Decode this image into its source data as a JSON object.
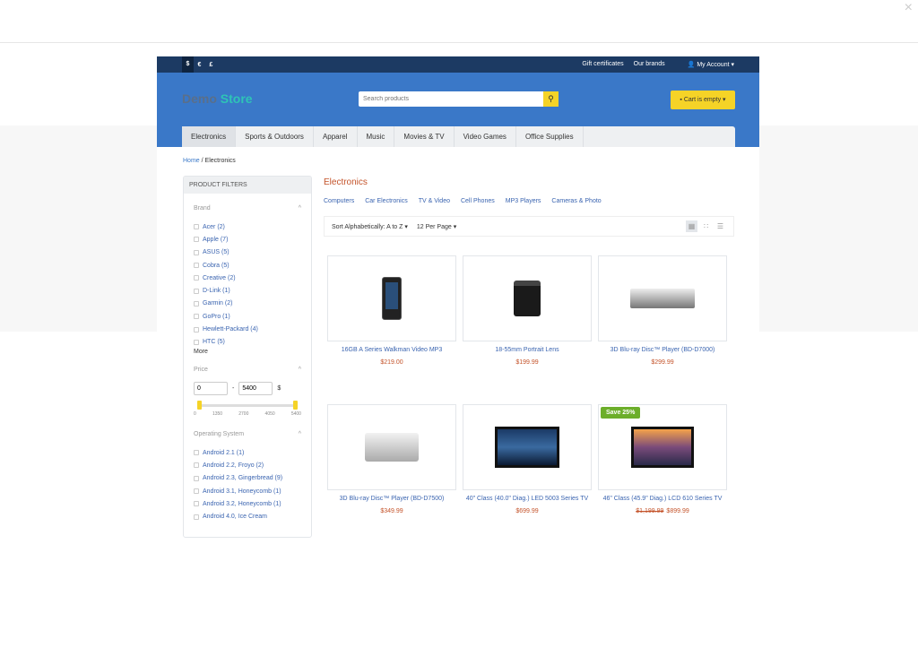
{
  "window": {
    "close_icon": "×"
  },
  "topbar": {
    "currencies": [
      "$",
      "€",
      "£"
    ],
    "links": [
      "Gift certificates",
      "Our brands"
    ],
    "account": "My Account ▾"
  },
  "header": {
    "logo_a": "Demo",
    "logo_b": "Store",
    "search_placeholder": "Search products",
    "cart": "Cart is empty ▾"
  },
  "nav": [
    "Electronics",
    "Sports & Outdoors",
    "Apparel",
    "Music",
    "Movies & TV",
    "Video Games",
    "Office Supplies"
  ],
  "breadcrumb": {
    "home": "Home",
    "sep": "/",
    "current": "Electronics"
  },
  "filters": {
    "title": "PRODUCT FILTERS",
    "brand": {
      "title": "Brand",
      "items": [
        "Acer  (2)",
        "Apple  (7)",
        "ASUS  (5)",
        "Cobra  (5)",
        "Creative  (2)",
        "D-Link  (1)",
        "Garmin  (2)",
        "GoPro  (1)",
        "Hewlett-Packard  (4)",
        "HTC  (5)"
      ],
      "more": "More"
    },
    "price": {
      "title": "Price",
      "min": "0",
      "max": "5400",
      "sep": "-",
      "currency": "$",
      "ticks": [
        "0",
        "1350",
        "2700",
        "4050",
        "5400"
      ]
    },
    "os": {
      "title": "Operating System",
      "items": [
        "Android 2.1  (1)",
        "Android 2.2, Froyo  (2)",
        "Android 2.3, Gingerbread  (9)",
        "Android 3.1, Honeycomb  (1)",
        "Android 3.2, Honeycomb  (1)",
        "Android 4.0, Ice Cream"
      ]
    }
  },
  "main": {
    "title": "Electronics",
    "subcategories": [
      "Computers",
      "Car Electronics",
      "TV & Video",
      "Cell Phones",
      "MP3 Players",
      "Cameras & Photo"
    ],
    "sort": "Sort Alphabetically: A to Z ▾",
    "per_page": "12 Per Page ▾"
  },
  "products": [
    {
      "name": "16GB A Series Walkman Video MP3",
      "price": "$219.00"
    },
    {
      "name": "18-55mm Portrait Lens",
      "price": "$199.99"
    },
    {
      "name": "3D Blu-ray Disc™ Player (BD-D7000)",
      "price": "$299.99"
    },
    {
      "name": "3D Blu-ray Disc™ Player (BD-D7500)",
      "price": "$349.99"
    },
    {
      "name": "40\" Class (40.0\" Diag.) LED 5003 Series TV",
      "price": "$699.99"
    },
    {
      "name": "46\" Class (45.9\" Diag.) LCD 610 Series TV",
      "old_price": "$1,199.99",
      "price": "$899.99",
      "badge": "Save 25%"
    }
  ]
}
